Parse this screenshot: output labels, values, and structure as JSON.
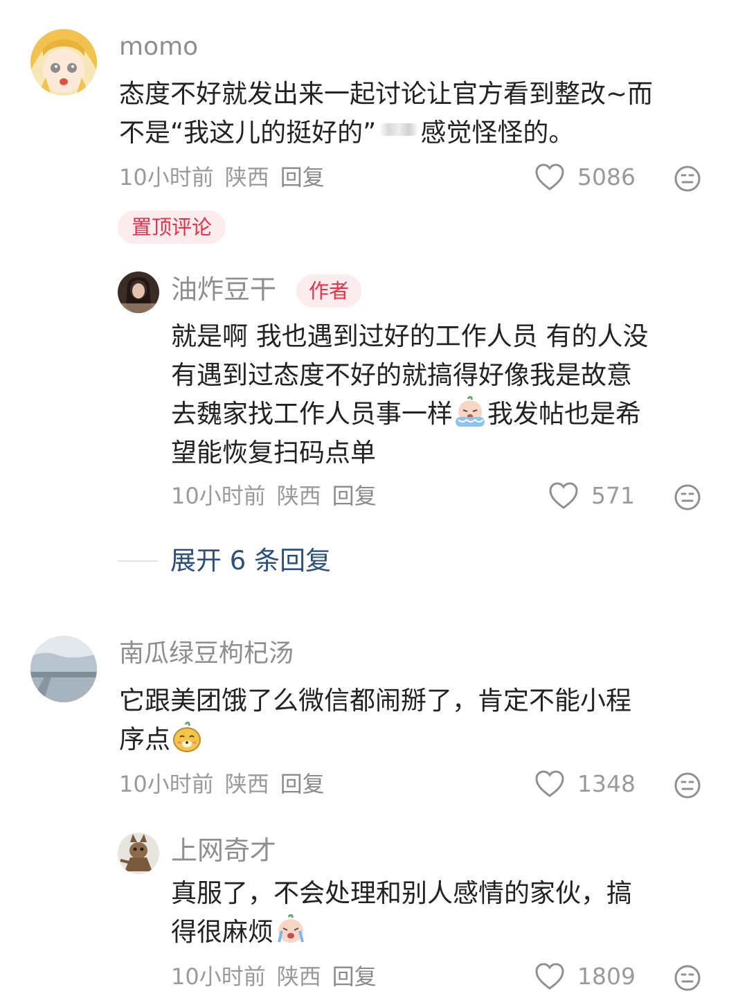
{
  "comments": [
    {
      "username": "momo",
      "lines": [
        "态度不好就发出来一起讨论让官方看到整改~而",
        "不是“我这儿的挺好的”",
        "感觉怪怪的。"
      ],
      "time": "10小时前",
      "location": "陕西",
      "reply_label": "回复",
      "likes": "5086",
      "pinned_label": "置顶评论",
      "reply": {
        "username": "油炸豆干",
        "badge": "作者",
        "lines": [
          "就是啊 我也遇到过好的工作人员 有的人没",
          "有遇到过态度不好的就搞得好像我是故意",
          "去魏家找工作人员事一样",
          "我发帖也是希",
          "望能恢复扫码点单"
        ],
        "time": "10小时前",
        "location": "陕西",
        "reply_label": "回复",
        "likes": "571"
      },
      "expand_label": "展开 6 条回复"
    },
    {
      "username": "南瓜绿豆枸杞汤",
      "lines": [
        "它跟美团饿了么微信都闹掰了，肯定不能小程",
        "序点"
      ],
      "time": "10小时前",
      "location": "陕西",
      "reply_label": "回复",
      "likes": "1348",
      "reply": {
        "username": "上网奇才",
        "lines": [
          "真服了，不会处理和别人感情的家伙，搞",
          "得很麻烦"
        ],
        "time": "10小时前",
        "location": "陕西",
        "reply_label": "回复",
        "likes": "1809"
      }
    }
  ],
  "icons": {
    "like": "heart-outline-icon",
    "react": "neutral-face-icon",
    "crying_emoji": "crying-sticker-icon",
    "dog_emoji": "smiling-dog-sticker-icon"
  },
  "colors": {
    "accent_red": "#e8314a",
    "badge_bg": "#fdecee",
    "link_blue": "#2b4e7a"
  }
}
